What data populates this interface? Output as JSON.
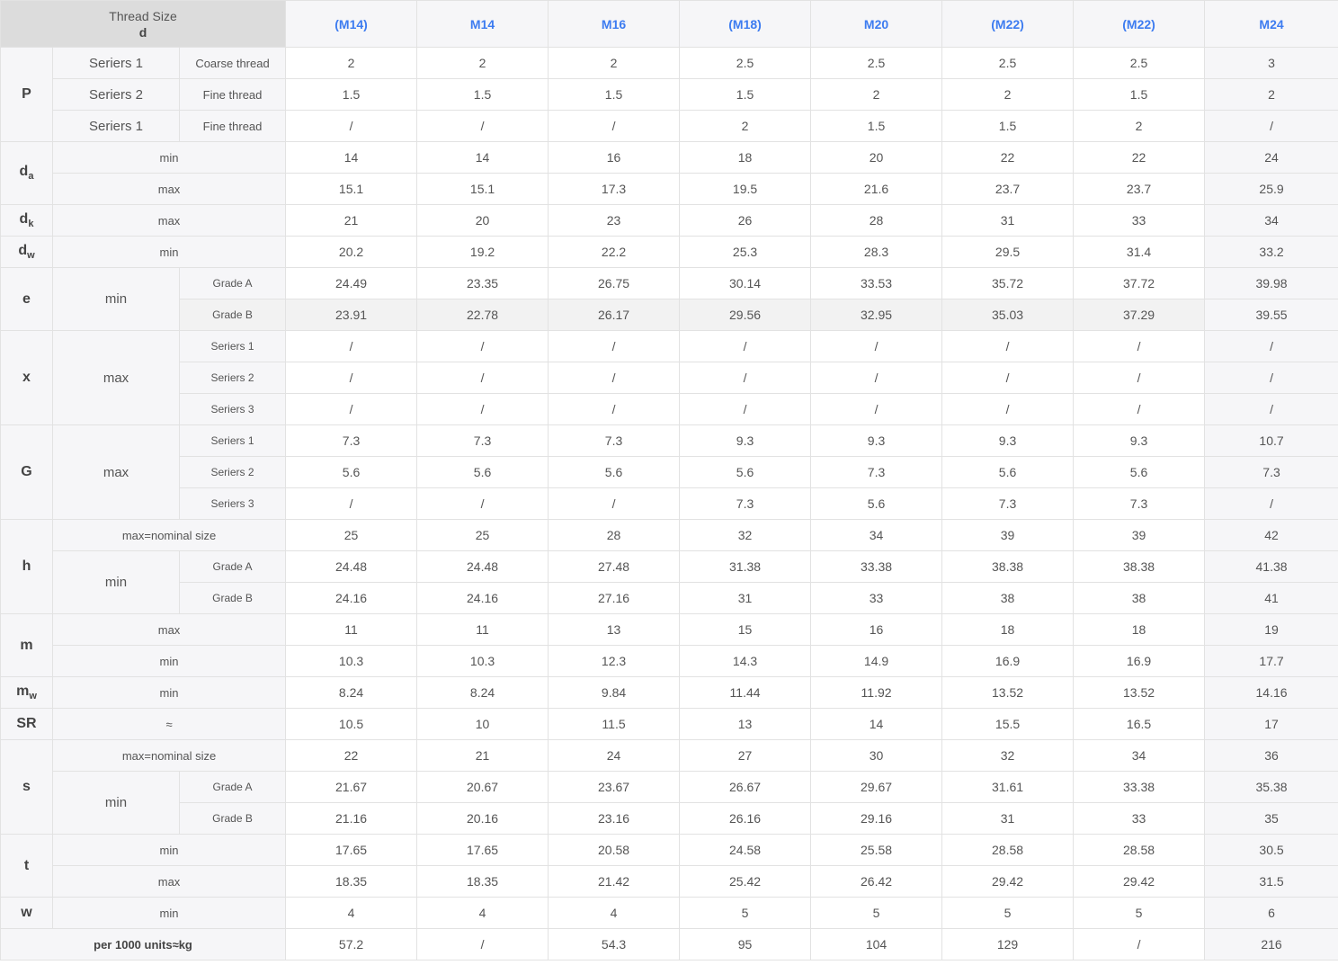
{
  "header": {
    "corner_line1": "Thread Size",
    "corner_line2": "d",
    "sizes": [
      "(M14)",
      "M14",
      "M16",
      "(M18)",
      "M20",
      "(M22)",
      "(M22)",
      "M24"
    ]
  },
  "params": {
    "P": "P",
    "da": "d",
    "da_sub": "a",
    "dk": "d",
    "dk_sub": "k",
    "dw": "d",
    "dw_sub": "w",
    "e": "e",
    "x": "x",
    "G": "G",
    "h": "h",
    "m": "m",
    "mw": "m",
    "mw_sub": "w",
    "SR": "SR",
    "s": "s",
    "t": "t",
    "w": "w"
  },
  "labels": {
    "p_r1_a": "Seriers 1",
    "p_r1_b": "Coarse thread",
    "p_r2_a": "Seriers 2",
    "p_r2_b": "Fine thread",
    "p_r3_a": "Seriers 1",
    "p_r3_b": "Fine thread",
    "min": "min",
    "max": "max",
    "grade_a": "Grade A",
    "grade_b": "Grade B",
    "series1": "Seriers 1",
    "series2": "Seriers 2",
    "series3": "Seriers 3",
    "max_nominal": "max=nominal size",
    "approx": "≈",
    "per1000": "per 1000 units≈kg"
  },
  "rows": {
    "p1": [
      "2",
      "2",
      "2",
      "2.5",
      "2.5",
      "2.5",
      "2.5",
      "3"
    ],
    "p2": [
      "1.5",
      "1.5",
      "1.5",
      "1.5",
      "2",
      "2",
      "1.5",
      "2"
    ],
    "p3": [
      "/",
      "/",
      "/",
      "2",
      "1.5",
      "1.5",
      "2",
      "/"
    ],
    "da_min": [
      "14",
      "14",
      "16",
      "18",
      "20",
      "22",
      "22",
      "24"
    ],
    "da_max": [
      "15.1",
      "15.1",
      "17.3",
      "19.5",
      "21.6",
      "23.7",
      "23.7",
      "25.9"
    ],
    "dk_max": [
      "21",
      "20",
      "23",
      "26",
      "28",
      "31",
      "33",
      "34"
    ],
    "dw_min": [
      "20.2",
      "19.2",
      "22.2",
      "25.3",
      "28.3",
      "29.5",
      "31.4",
      "33.2"
    ],
    "e_a": [
      "24.49",
      "23.35",
      "26.75",
      "30.14",
      "33.53",
      "35.72",
      "37.72",
      "39.98"
    ],
    "e_b": [
      "23.91",
      "22.78",
      "26.17",
      "29.56",
      "32.95",
      "35.03",
      "37.29",
      "39.55"
    ],
    "x1": [
      "/",
      "/",
      "/",
      "/",
      "/",
      "/",
      "/",
      "/"
    ],
    "x2": [
      "/",
      "/",
      "/",
      "/",
      "/",
      "/",
      "/",
      "/"
    ],
    "x3": [
      "/",
      "/",
      "/",
      "/",
      "/",
      "/",
      "/",
      "/"
    ],
    "g1": [
      "7.3",
      "7.3",
      "7.3",
      "9.3",
      "9.3",
      "9.3",
      "9.3",
      "10.7"
    ],
    "g2": [
      "5.6",
      "5.6",
      "5.6",
      "5.6",
      "7.3",
      "5.6",
      "5.6",
      "7.3"
    ],
    "g3": [
      "/",
      "/",
      "/",
      "7.3",
      "5.6",
      "7.3",
      "7.3",
      "/"
    ],
    "h_max": [
      "25",
      "25",
      "28",
      "32",
      "34",
      "39",
      "39",
      "42"
    ],
    "h_a": [
      "24.48",
      "24.48",
      "27.48",
      "31.38",
      "33.38",
      "38.38",
      "38.38",
      "41.38"
    ],
    "h_b": [
      "24.16",
      "24.16",
      "27.16",
      "31",
      "33",
      "38",
      "38",
      "41"
    ],
    "m_max": [
      "11",
      "11",
      "13",
      "15",
      "16",
      "18",
      "18",
      "19"
    ],
    "m_min": [
      "10.3",
      "10.3",
      "12.3",
      "14.3",
      "14.9",
      "16.9",
      "16.9",
      "17.7"
    ],
    "mw_min": [
      "8.24",
      "8.24",
      "9.84",
      "11.44",
      "11.92",
      "13.52",
      "13.52",
      "14.16"
    ],
    "sr": [
      "10.5",
      "10",
      "11.5",
      "13",
      "14",
      "15.5",
      "16.5",
      "17"
    ],
    "s_max": [
      "22",
      "21",
      "24",
      "27",
      "30",
      "32",
      "34",
      "36"
    ],
    "s_a": [
      "21.67",
      "20.67",
      "23.67",
      "26.67",
      "29.67",
      "31.61",
      "33.38",
      "35.38"
    ],
    "s_b": [
      "21.16",
      "20.16",
      "23.16",
      "26.16",
      "29.16",
      "31",
      "33",
      "35"
    ],
    "t_min": [
      "17.65",
      "17.65",
      "20.58",
      "24.58",
      "25.58",
      "28.58",
      "28.58",
      "30.5"
    ],
    "t_max": [
      "18.35",
      "18.35",
      "21.42",
      "25.42",
      "26.42",
      "29.42",
      "29.42",
      "31.5"
    ],
    "w_min": [
      "4",
      "4",
      "4",
      "5",
      "5",
      "5",
      "5",
      "6"
    ],
    "weight": [
      "57.2",
      "/",
      "54.3",
      "95",
      "104",
      "129",
      "/",
      "216"
    ]
  }
}
